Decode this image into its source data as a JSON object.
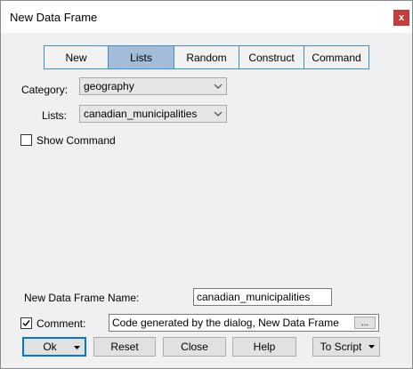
{
  "window": {
    "title": "New Data Frame",
    "close_label": "x"
  },
  "tabs": [
    {
      "label": "New",
      "active": false
    },
    {
      "label": "Lists",
      "active": true
    },
    {
      "label": "Random",
      "active": false
    },
    {
      "label": "Construct",
      "active": false
    },
    {
      "label": "Command",
      "active": false
    }
  ],
  "category": {
    "label": "Category:",
    "value": "geography"
  },
  "lists": {
    "label": "Lists:",
    "value": "canadian_municipalities"
  },
  "show_command": {
    "label": "Show Command",
    "checked": false
  },
  "new_name": {
    "label": "New Data Frame Name:",
    "value": "canadian_municipalities"
  },
  "comment": {
    "label": "Comment:",
    "checked": true,
    "value": "Code generated by the dialog, New Data Frame",
    "browse_label": "..."
  },
  "buttons": {
    "ok": "Ok",
    "reset": "Reset",
    "close": "Close",
    "help": "Help",
    "to_script": "To Script"
  },
  "colors": {
    "accent": "#3c8ecf",
    "active_tab": "#a3bcd8",
    "close_button": "#c43c3c"
  }
}
